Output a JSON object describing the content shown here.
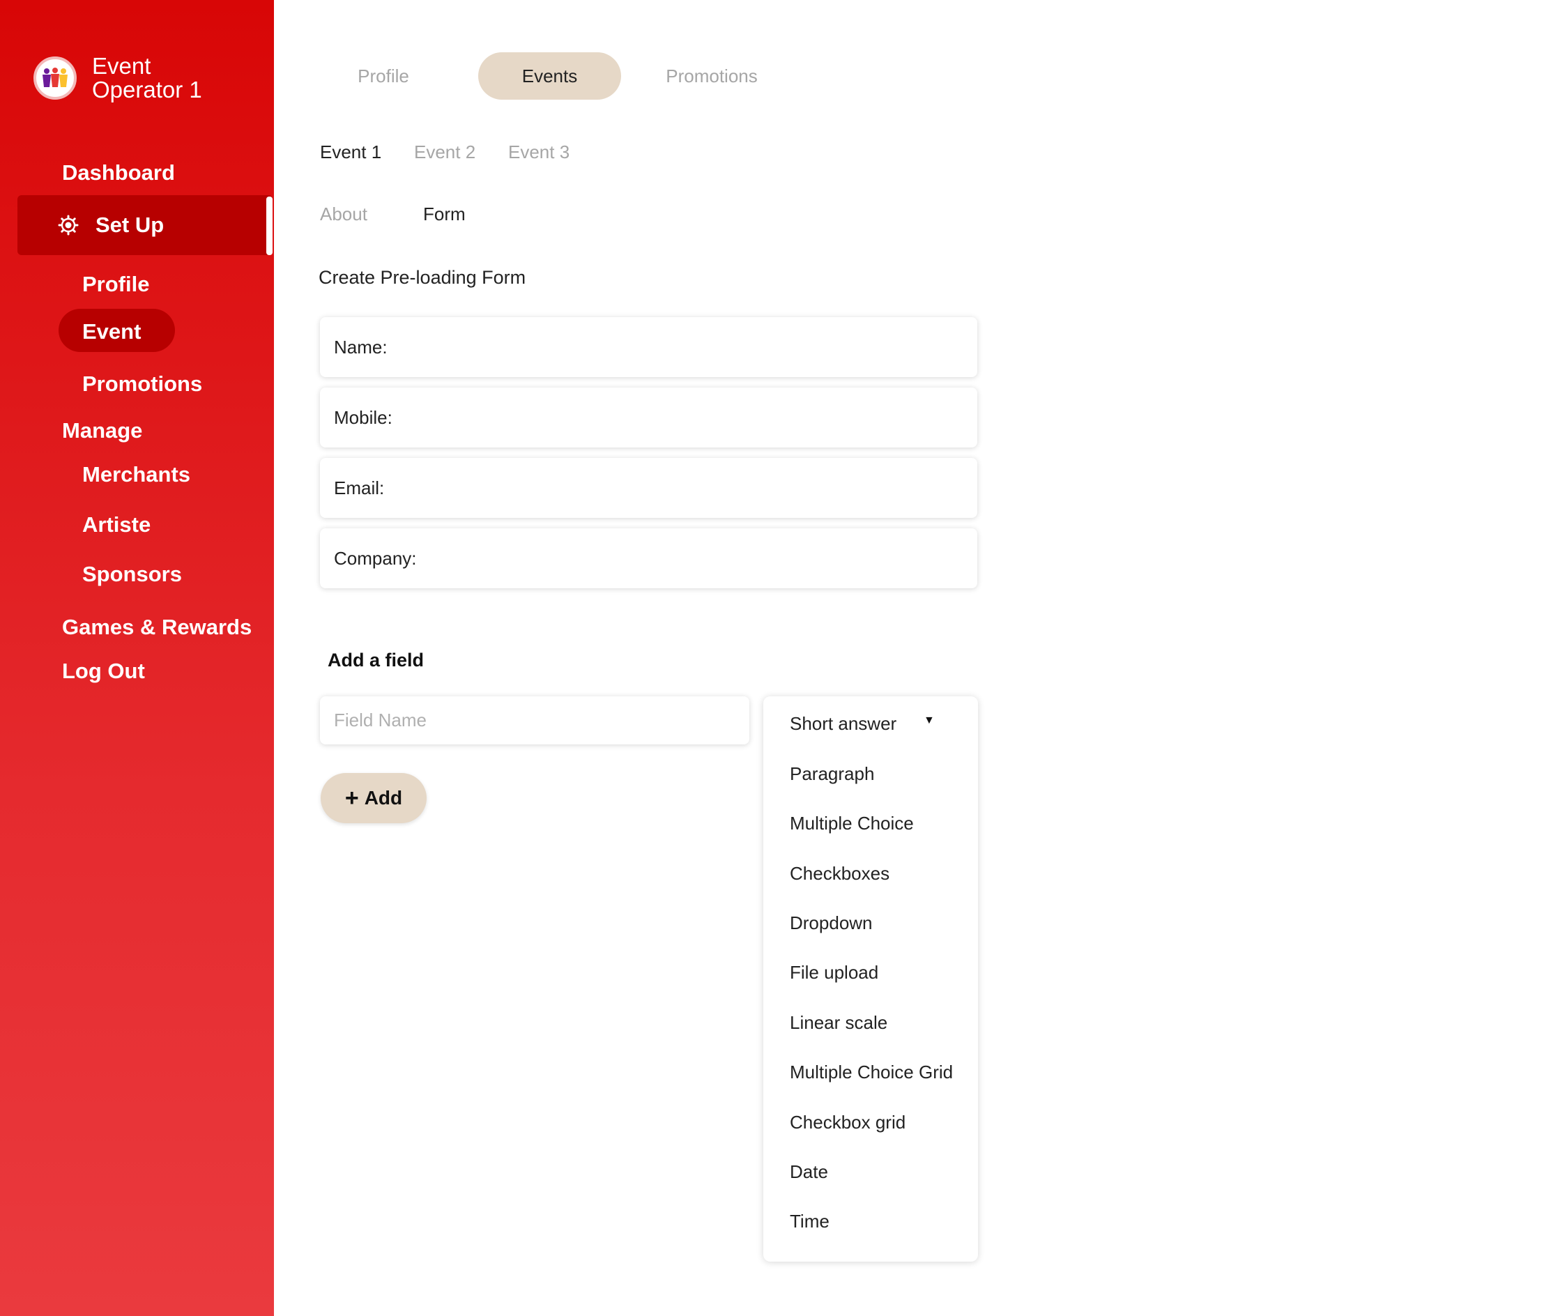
{
  "brand": {
    "line1": "Event",
    "line2": "Operator 1"
  },
  "sidebar": {
    "dashboard": "Dashboard",
    "setup": "Set Up",
    "profile": "Profile",
    "event": "Event",
    "promotions": "Promotions",
    "manage": "Manage",
    "merchants": "Merchants",
    "artiste": "Artiste",
    "sponsors": "Sponsors",
    "games": "Games & Rewards",
    "logout": "Log Out"
  },
  "top_tabs": [
    "Profile",
    "Events",
    "Promotions"
  ],
  "event_tabs": [
    "Event 1",
    "Event 2",
    "Event 3"
  ],
  "sub_tabs": [
    "About",
    "Form"
  ],
  "form": {
    "title": "Create Pre-loading Form",
    "fields": [
      "Name:",
      "Mobile:",
      "Email:",
      "Company:"
    ]
  },
  "add_field": {
    "title": "Add a field",
    "placeholder": "Field Name",
    "add_label": "Add",
    "selected_type": "Short answer",
    "type_options": [
      "Paragraph",
      "Multiple Choice",
      "Checkboxes",
      "Dropdown",
      "File upload",
      "Linear scale",
      "Multiple Choice Grid",
      "Checkbox grid",
      "Date",
      "Time"
    ]
  },
  "colors": {
    "sidebar_red": "#d80606",
    "active_red": "#b70000",
    "pill_beige": "#e6d8c7"
  }
}
